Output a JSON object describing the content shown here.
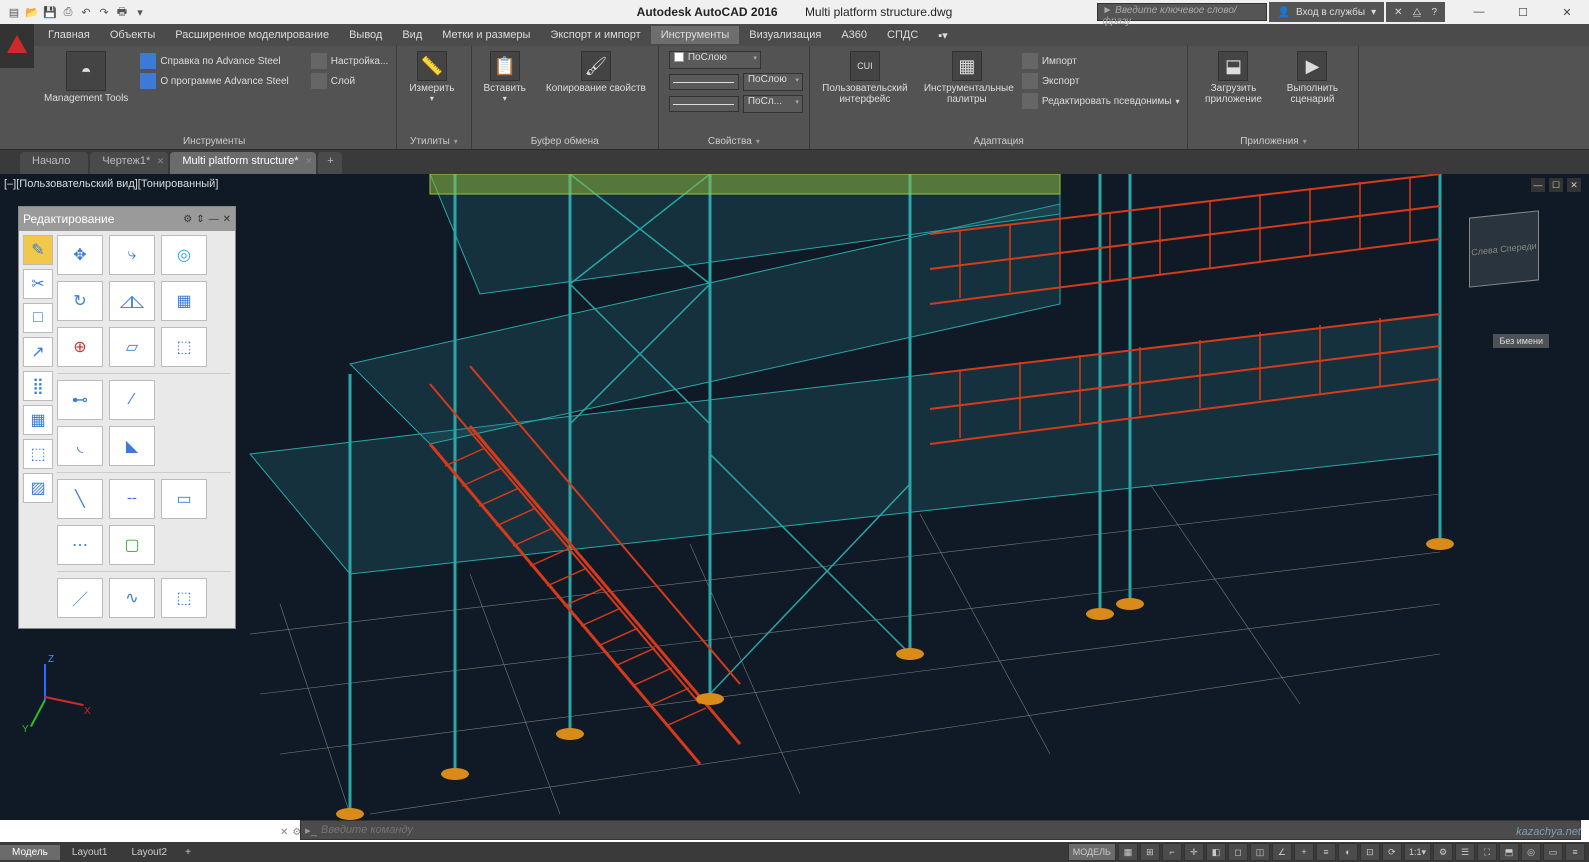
{
  "title": {
    "app": "Autodesk AutoCAD 2016",
    "file": "Multi platform structure.dwg"
  },
  "search": {
    "placeholder": "Введите ключевое слово/фразу"
  },
  "account": {
    "label": "Вход в службы"
  },
  "menu": {
    "items": [
      "Главная",
      "Объекты",
      "Расширенное моделирование",
      "Вывод",
      "Вид",
      "Метки и размеры",
      "Экспорт и импорт",
      "Инструменты",
      "Визуализация",
      "A360",
      "СПДС"
    ],
    "active": 7
  },
  "ribbon": {
    "management": "Management Tools",
    "help_steel": "Справка по Advance Steel",
    "about_steel": "О программе Advance Steel",
    "panel_tools": "Инструменты",
    "settings": "Настройка...",
    "layer": "Слой",
    "measure": "Измерить",
    "panel_util": "Утилиты",
    "paste": "Вставить",
    "copy_props": "Копирование свойств",
    "panel_clip": "Буфер обмена",
    "bylayer": "ПоСлою",
    "bylayer2": "ПоСлою",
    "bylayer3": "ПоСл...",
    "panel_props": "Свойства",
    "cui": "Пользовательский интерфейс",
    "cui_ico": "CUI",
    "palettes": "Инструментальные палитры",
    "import": "Импорт",
    "export": "Экспорт",
    "edit_aliases": "Редактировать псевдонимы",
    "panel_adapt": "Адаптация",
    "load_app": "Загрузить приложение",
    "run_script": "Выполнить сценарий",
    "panel_apps": "Приложения"
  },
  "filetabs": {
    "items": [
      "Начало",
      "Чертеж1*",
      "Multi platform structure*"
    ],
    "active": 2
  },
  "viewport": {
    "label": "[–][Пользовательский вид][Тонированный]",
    "cube_face1": "Слева",
    "cube_face2": "Спереди",
    "unnamed": "Без имени"
  },
  "palette": {
    "title": "Редактирование"
  },
  "command": {
    "placeholder": "Введите команду"
  },
  "layout": {
    "tabs": [
      "Модель",
      "Layout1",
      "Layout2"
    ],
    "active": 0
  },
  "status": {
    "model": "МОДЕЛЬ",
    "scale": "1:1",
    "units_icon": "✎"
  },
  "ucs": {
    "x": "X",
    "y": "Y",
    "z": "Z"
  },
  "watermark": "kazachya.net"
}
